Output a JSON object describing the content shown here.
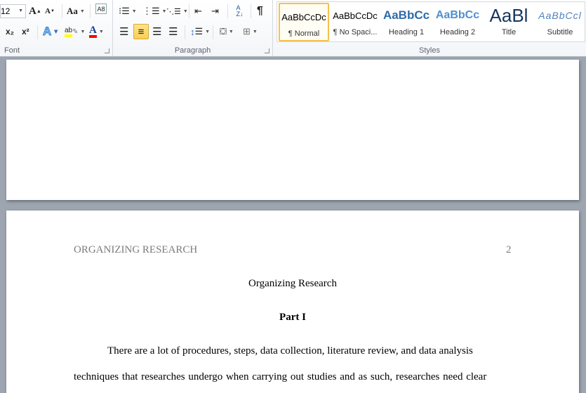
{
  "ribbon": {
    "font": {
      "label": "Font",
      "size": "12",
      "grow": "A",
      "shrink": "A",
      "case": "Aa",
      "clear": "A8",
      "subscript": "x₂",
      "superscript": "x²",
      "effects": "A",
      "highlight": "ab",
      "highlight_color": "#ffff00",
      "font_color": "A",
      "font_color_value": "#ff0000"
    },
    "paragraph": {
      "label": "Paragraph",
      "pilcrow": "¶",
      "sort": "A Z↓",
      "active_alignment": "center"
    },
    "styles": {
      "label": "Styles",
      "items": [
        {
          "preview": "AaBbCcDc",
          "name": "¶ Normal",
          "selected": true
        },
        {
          "preview": "AaBbCcDc",
          "name": "¶ No Spaci..."
        },
        {
          "preview": "AaBbCc",
          "name": "Heading 1"
        },
        {
          "preview": "AaBbCc",
          "name": "Heading 2"
        },
        {
          "preview": "AaBl",
          "name": "Title"
        },
        {
          "preview": "AaBbCcl",
          "name": "Subtitle"
        }
      ]
    }
  },
  "document": {
    "running_head": "ORGANIZING RESEARCH",
    "page_number": "2",
    "title": "Organizing Research",
    "part": "Part I",
    "lines": [
      "There are a lot of procedures, steps, data collection, literature review, and data analysis",
      "techniques that researches  undergo when carrying  out studies and as such, researches  need clear"
    ]
  }
}
